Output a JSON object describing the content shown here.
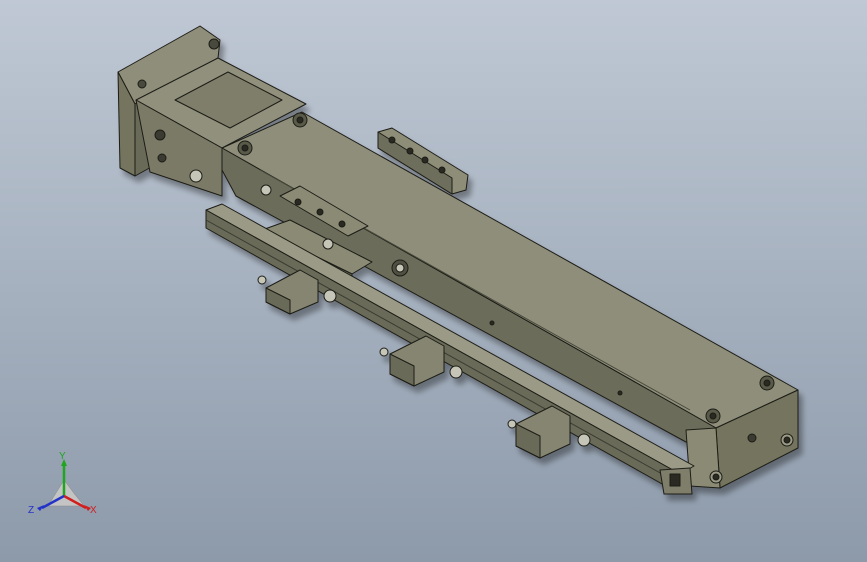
{
  "viewport": {
    "background_top": "#bfc8d4",
    "background_bottom": "#8d9aaa",
    "model_color": "#7a7a66"
  },
  "triad": {
    "x_label": "X",
    "y_label": "Y",
    "z_label": "Z",
    "x_color": "#d21e1e",
    "y_color": "#1fa51f",
    "z_color": "#2333c8"
  }
}
